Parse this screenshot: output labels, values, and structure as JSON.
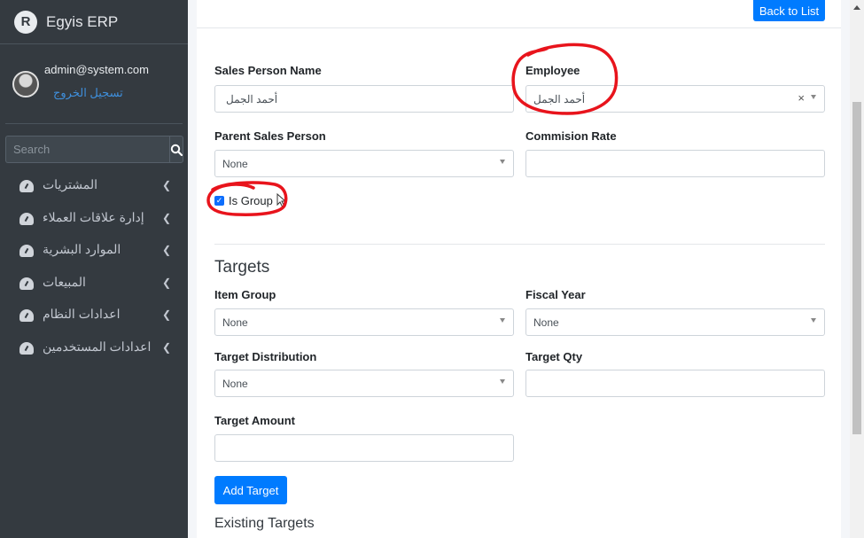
{
  "app": {
    "brand": "Egyis ERP",
    "logo_letter": "R"
  },
  "user": {
    "email": "admin@system.com",
    "logout": "تسجيل الخروج"
  },
  "sidebar": {
    "search_placeholder": "Search",
    "items": [
      {
        "label": "المشتريات",
        "icon": "dashboard-gauge-icon"
      },
      {
        "label": "إدارة علاقات العملاء",
        "icon": "dashboard-gauge-icon"
      },
      {
        "label": "الموارد البشرية",
        "icon": "dashboard-gauge-icon"
      },
      {
        "label": "المبيعات",
        "icon": "dashboard-gauge-icon"
      },
      {
        "label": "اعدادات النظام",
        "icon": "dashboard-gauge-icon"
      },
      {
        "label": "اعدادات المستخدمين",
        "icon": "dashboard-gauge-icon"
      }
    ]
  },
  "form": {
    "back_button": "Back to List",
    "sales_person_name": {
      "label": "Sales Person Name",
      "value": "أحمد الجمل"
    },
    "employee": {
      "label": "Employee",
      "value": "أحمد الجمل",
      "clear": "×"
    },
    "parent_sales_person": {
      "label": "Parent Sales Person",
      "value": "None"
    },
    "commision_rate": {
      "label": "Commision Rate",
      "value": ""
    },
    "is_group": {
      "label": "Is Group",
      "checked": true,
      "check_mark": "✓"
    }
  },
  "targets": {
    "title": "Targets",
    "item_group": {
      "label": "Item Group",
      "value": "None"
    },
    "fiscal_year": {
      "label": "Fiscal Year",
      "value": "None"
    },
    "target_distribution": {
      "label": "Target Distribution",
      "value": "None"
    },
    "target_qty": {
      "label": "Target Qty",
      "value": ""
    },
    "target_amount": {
      "label": "Target Amount",
      "value": ""
    },
    "add_button": "Add Target",
    "existing_title": "Existing Targets"
  },
  "colors": {
    "primary": "#007bff",
    "sidebar_bg": "#343a40",
    "annotation": "#e8141c"
  }
}
